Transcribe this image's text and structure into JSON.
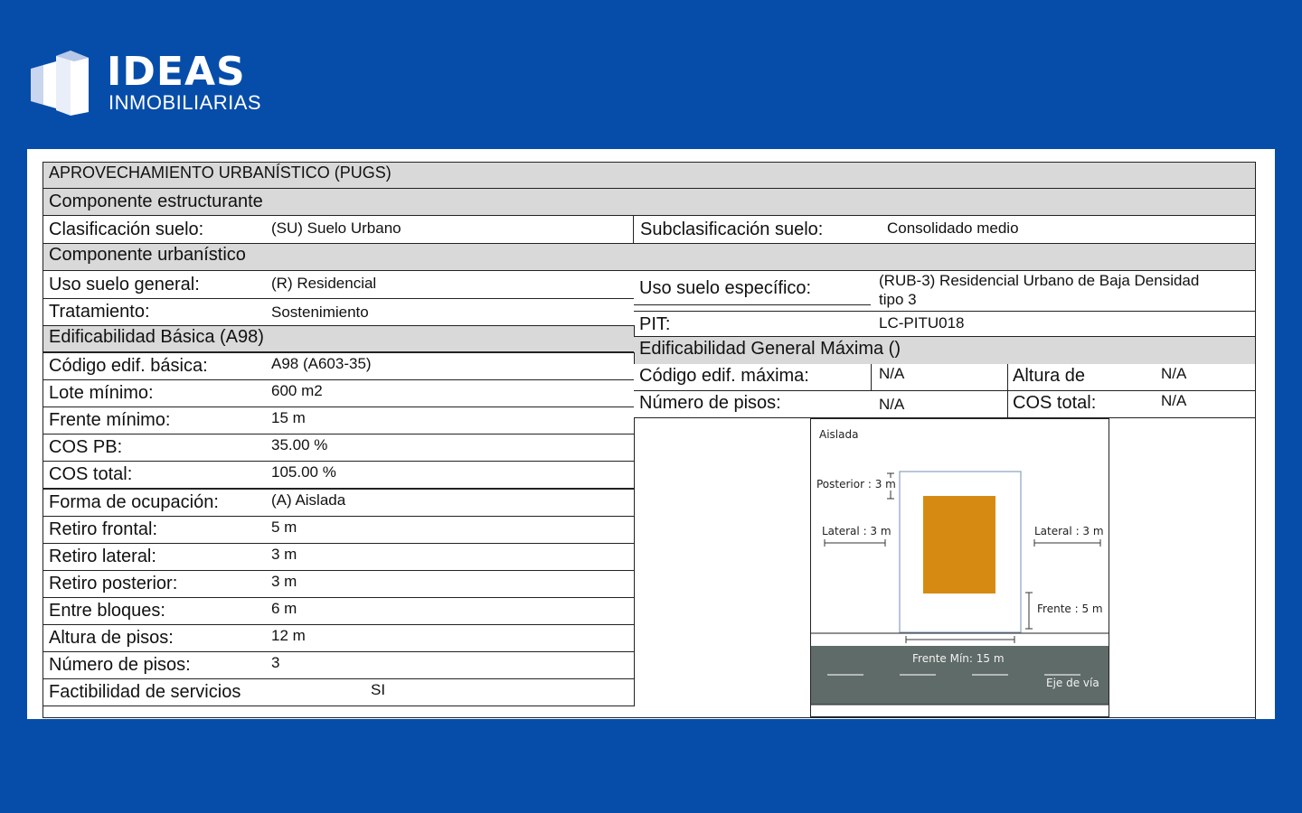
{
  "brand": {
    "name": "IDEAS",
    "tagline": "INMOBILIARIAS"
  },
  "sheet": {
    "title": "APROVECHAMIENTO URBANÍSTICO (PUGS)",
    "componente_estructurante": "Componente  estructurante",
    "clasificacion_label": "Clasificación suelo:",
    "clasificacion_value": "(SU) Suelo Urbano",
    "subclasificacion_label": "Subclasificación suelo:",
    "subclasificacion_value": "Consolidado medio",
    "componente_urbanistico": "Componente  urbanístico",
    "uso_general_label": "Uso suelo general:",
    "uso_general_value": "(R) Residencial",
    "uso_especifico_label": "Uso suelo específico:",
    "uso_especifico_value_line1": "(RUB-3) Residencial Urbano de Baja Densidad",
    "uso_especifico_value_line2": "tipo 3",
    "tratamiento_label": "Tratamiento:",
    "tratamiento_value": "Sostenimiento",
    "pit_label": "PIT:",
    "pit_value": "LC-PITU018",
    "edif_basica_title": "Edificabilidad Básica (A98)",
    "edif_general_title": "Edificabilidad General Máxima ()",
    "basica_rows": [
      {
        "label": "Código edif. básica:",
        "value": "A98 (A603-35)"
      },
      {
        "label": "Lote mínimo:",
        "value": "600 m2"
      },
      {
        "label": "Frente mínimo:",
        "value": "15 m"
      },
      {
        "label": "COS PB:",
        "value": "35.00 %"
      },
      {
        "label": "COS total:",
        "value": "105.00 %"
      },
      {
        "label": "Forma de ocupación:",
        "value": "(A) Aislada"
      },
      {
        "label": "Retiro frontal:",
        "value": "5 m"
      },
      {
        "label": "Retiro lateral:",
        "value": "3 m"
      },
      {
        "label": "Retiro posterior:",
        "value": "3 m"
      },
      {
        "label": "Entre bloques:",
        "value": "6 m"
      },
      {
        "label": "Altura de pisos:",
        "value": "12 m"
      },
      {
        "label": "Número de pisos:",
        "value": "3"
      },
      {
        "label": "Factibilidad de servicios",
        "value": "SI"
      }
    ],
    "codigo_max_label": "Código edif. máxima:",
    "codigo_max_value": "N/A",
    "altura_label": "Altura de",
    "altura_value": "N/A",
    "numero_pisos_label": "Número de pisos:",
    "numero_pisos_value": "N/A",
    "cos_total_label": "COS total:",
    "cos_total_value": "N/A"
  },
  "diagram": {
    "title": "Aislada",
    "posterior": "Posterior : 3 m",
    "lateral_left": "Lateral : 3 m",
    "lateral_right": "Lateral : 3 m",
    "frente": "Frente : 5 m",
    "frente_min": "Frente Mín: 15 m",
    "eje_via": "Eje de vía",
    "colors": {
      "building": "#d78a12",
      "road": "#5f6b68"
    }
  }
}
